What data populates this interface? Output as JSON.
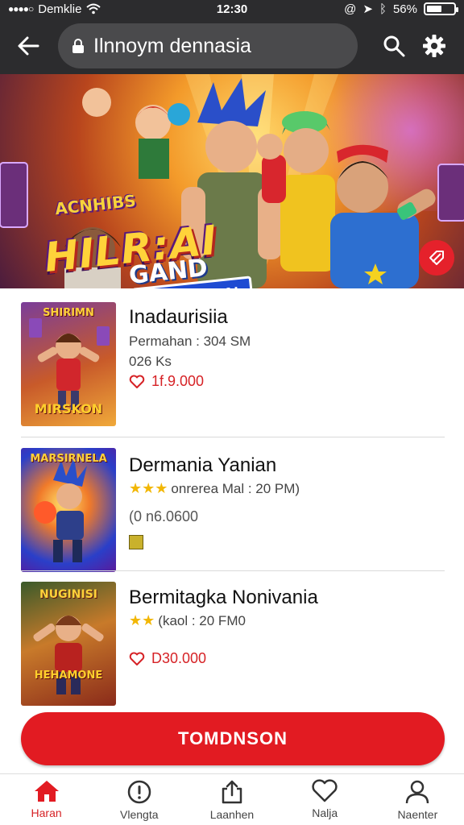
{
  "status_bar": {
    "carrier": "Demklie",
    "time": "12:30",
    "battery_text": "56%",
    "battery_level": 0.56
  },
  "app_bar": {
    "url_text": "Ilnnoym dennasia"
  },
  "banner": {
    "logo_top": "ACNHIBS",
    "logo_main": "HILR:AI",
    "logo_sub": "GAND",
    "logo_tag": "PERRDIAN"
  },
  "items": [
    {
      "title": "Inadaurisiia",
      "line1": "Permahan : 304 SM",
      "line2": "026 Ks",
      "price": "1f.9.000",
      "thumb_title": "SHIRIMN",
      "thumb_bottom": "MIRSKON"
    },
    {
      "title": "Dermania Yanian",
      "line1": "onrerea Mal : 20 PM)",
      "line2": "(0 n6.0600",
      "thumb_title": "MARSIRNELA",
      "thumb_bottom": ""
    },
    {
      "title": "Bermitagka Nonivania",
      "line1": "(kaol : 20 FM0",
      "price": "D30.000",
      "thumb_title": "NUGINISI",
      "thumb_bottom": "HEHAMONE"
    }
  ],
  "primary_button": {
    "label": "TOMDNSON"
  },
  "bottom_nav": [
    {
      "label": "Haran",
      "icon": "home-icon",
      "active": true
    },
    {
      "label": "Vlengta",
      "icon": "alert-circle-icon",
      "active": false
    },
    {
      "label": "Laanhen",
      "icon": "share-icon",
      "active": false
    },
    {
      "label": "Nalja",
      "icon": "heart-icon",
      "active": false
    },
    {
      "label": "Naenter",
      "icon": "profile-icon",
      "active": false
    }
  ],
  "colors": {
    "accent": "#e21b22",
    "bar_bg": "#2c2c2e",
    "pill_bg": "#4a4a4c",
    "star": "#f2b705"
  }
}
